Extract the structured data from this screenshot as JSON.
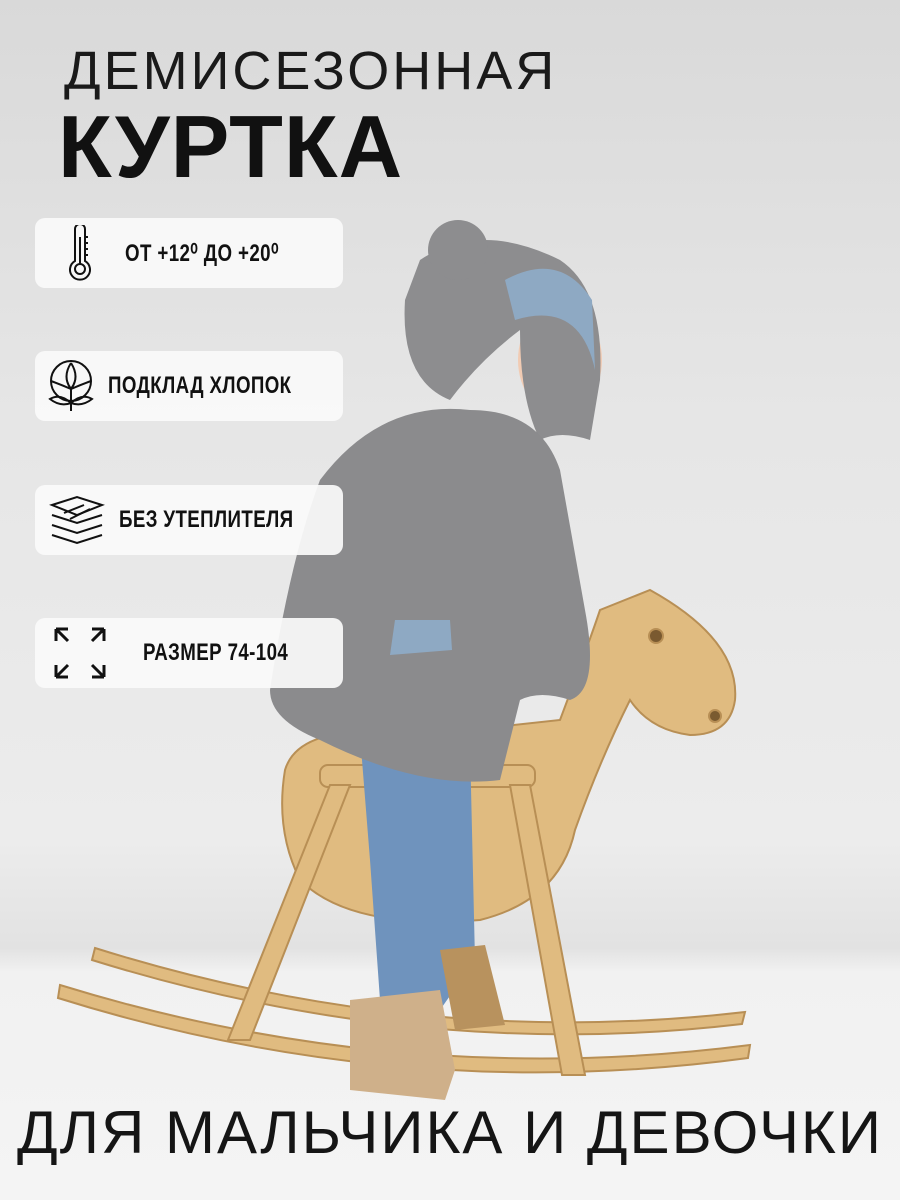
{
  "header": {
    "line1": "ДЕМИСЕЗОННАЯ",
    "line2": "КУРТКА"
  },
  "features": [
    {
      "icon": "thermometer-icon",
      "label": "ОТ +12⁰ ДО +20⁰"
    },
    {
      "icon": "cotton-icon",
      "label": "ПОДКЛАД ХЛОПОК"
    },
    {
      "icon": "layers-icon",
      "label": "БЕЗ УТЕПЛИТЕЛЯ"
    },
    {
      "icon": "expand-arrows-icon",
      "label": "РАЗМЕР 74-104"
    }
  ],
  "footer": {
    "text": "ДЛЯ МАЛЬЧИКА И ДЕВОЧКИ"
  }
}
